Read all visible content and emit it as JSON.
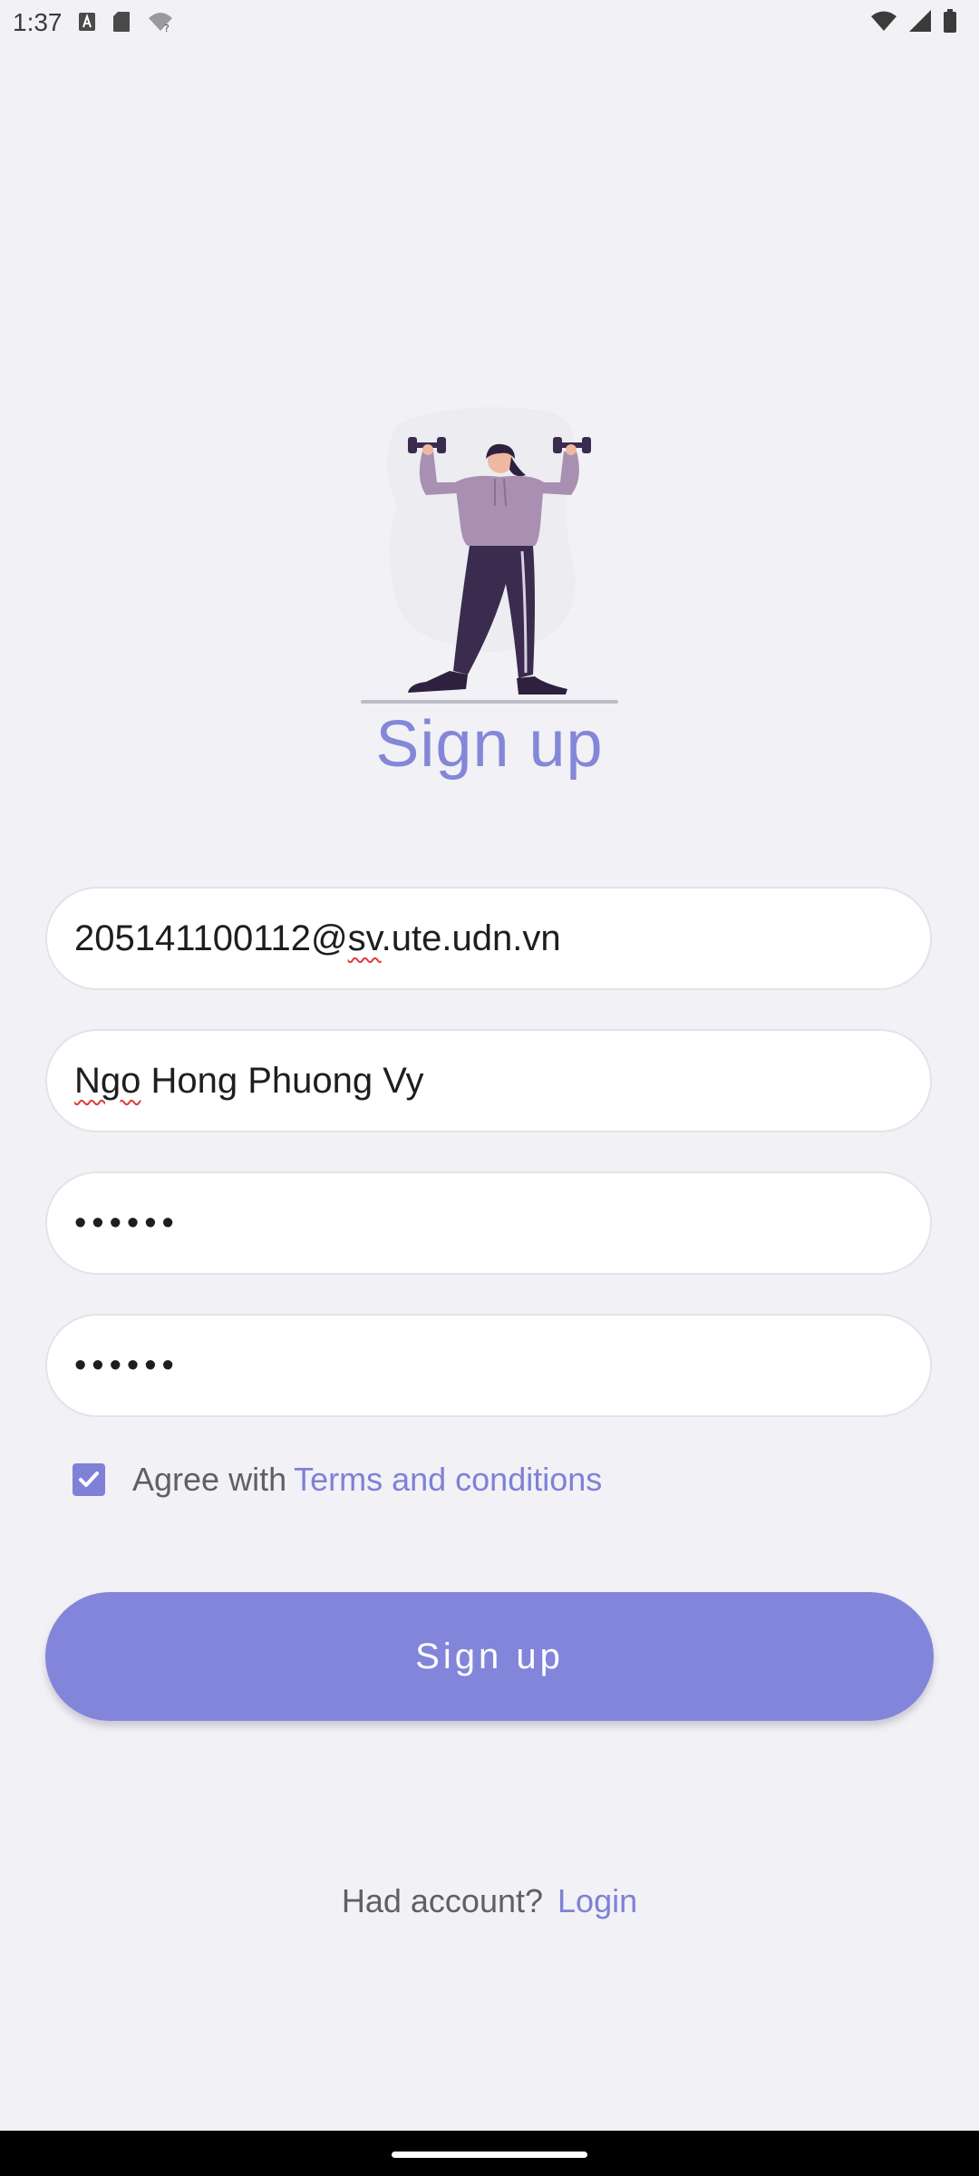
{
  "status_bar": {
    "time": "1:37",
    "left_icons": [
      "font-a-icon",
      "sd-card-icon",
      "wifi-question-icon"
    ],
    "right_icons": [
      "wifi-icon",
      "cell-signal-icon",
      "battery-icon"
    ]
  },
  "title": "Sign up",
  "form": {
    "email_value": "205141100112@sv.ute.udn.vn",
    "name_value": "Ngo Hong Phuong Vy",
    "password_value": "••••••",
    "confirm_password_value": "••••••",
    "agree_checked": true,
    "agree_text": "Agree with",
    "terms_link": "Terms and conditions",
    "signup_button": "Sign up"
  },
  "footer": {
    "had_account": "Had account?",
    "login_link": "Login"
  },
  "colors": {
    "accent": "#8285DA",
    "background": "#F2F1F5",
    "illustration_dark": "#3A2B4F",
    "illustration_hoodie": "#A98FB1"
  }
}
